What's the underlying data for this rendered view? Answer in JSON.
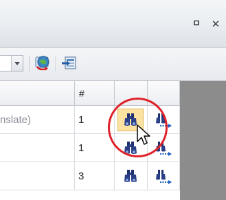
{
  "caption": {
    "pin_glyph": "ㅁ",
    "close_glyph": "✕"
  },
  "toolbar": {
    "combo_icon": "chevron-down-icon",
    "buttons": [
      {
        "name": "refresh-translation",
        "icon": "globe-refresh-icon"
      },
      {
        "name": "export",
        "icon": "export-icon"
      }
    ]
  },
  "grid": {
    "columns": [
      {
        "label": ""
      },
      {
        "label": "#"
      },
      {
        "label": ""
      },
      {
        "label": ""
      }
    ],
    "rows": [
      {
        "name": "nslate)",
        "count": "1",
        "hover": true
      },
      {
        "name": "",
        "count": "1",
        "hover": false
      },
      {
        "name": "",
        "count": "3",
        "hover": false
      }
    ],
    "find_icon": "binoculars-icon",
    "find_next_icon": "find-next-icon"
  },
  "colors": {
    "highlight": "#fbe2a0",
    "circle": "#e0222a",
    "dark_panel": "#8c8c8c"
  }
}
